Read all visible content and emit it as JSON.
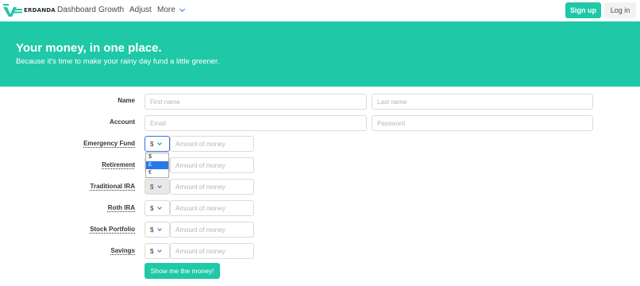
{
  "brand": {
    "name": "ERDANDA",
    "accent": "#1fc8a7",
    "link": "#3273dc"
  },
  "nav": {
    "items": [
      "Dashboard",
      "Growth",
      "Adjust",
      "More"
    ],
    "more_icon": "chevron-down-icon",
    "signup": "Sign up",
    "login": "Log in"
  },
  "hero": {
    "title": "Your money, in one place.",
    "subtitle": "Because it's time to make your rainy day fund a little greener."
  },
  "form": {
    "name_label": "Name",
    "first_name_placeholder": "First name",
    "last_name_placeholder": "Last name",
    "account_label": "Account",
    "email_placeholder": "Email",
    "password_placeholder": "Password",
    "currency_options": [
      "$",
      "£",
      "€"
    ],
    "currency_selected": "$",
    "dropdown_highlighted": "£",
    "amount_placeholder": "Amount of money",
    "funds": [
      {
        "label": "Emergency Fund",
        "currency": "$"
      },
      {
        "label": "Retirement",
        "currency": "$"
      },
      {
        "label": "Traditional IRA",
        "currency": "$"
      },
      {
        "label": "Roth IRA",
        "currency": "$"
      },
      {
        "label": "Stock Portfolio",
        "currency": "$"
      },
      {
        "label": "Savings",
        "currency": "$"
      }
    ],
    "submit": "Show me the money!"
  }
}
